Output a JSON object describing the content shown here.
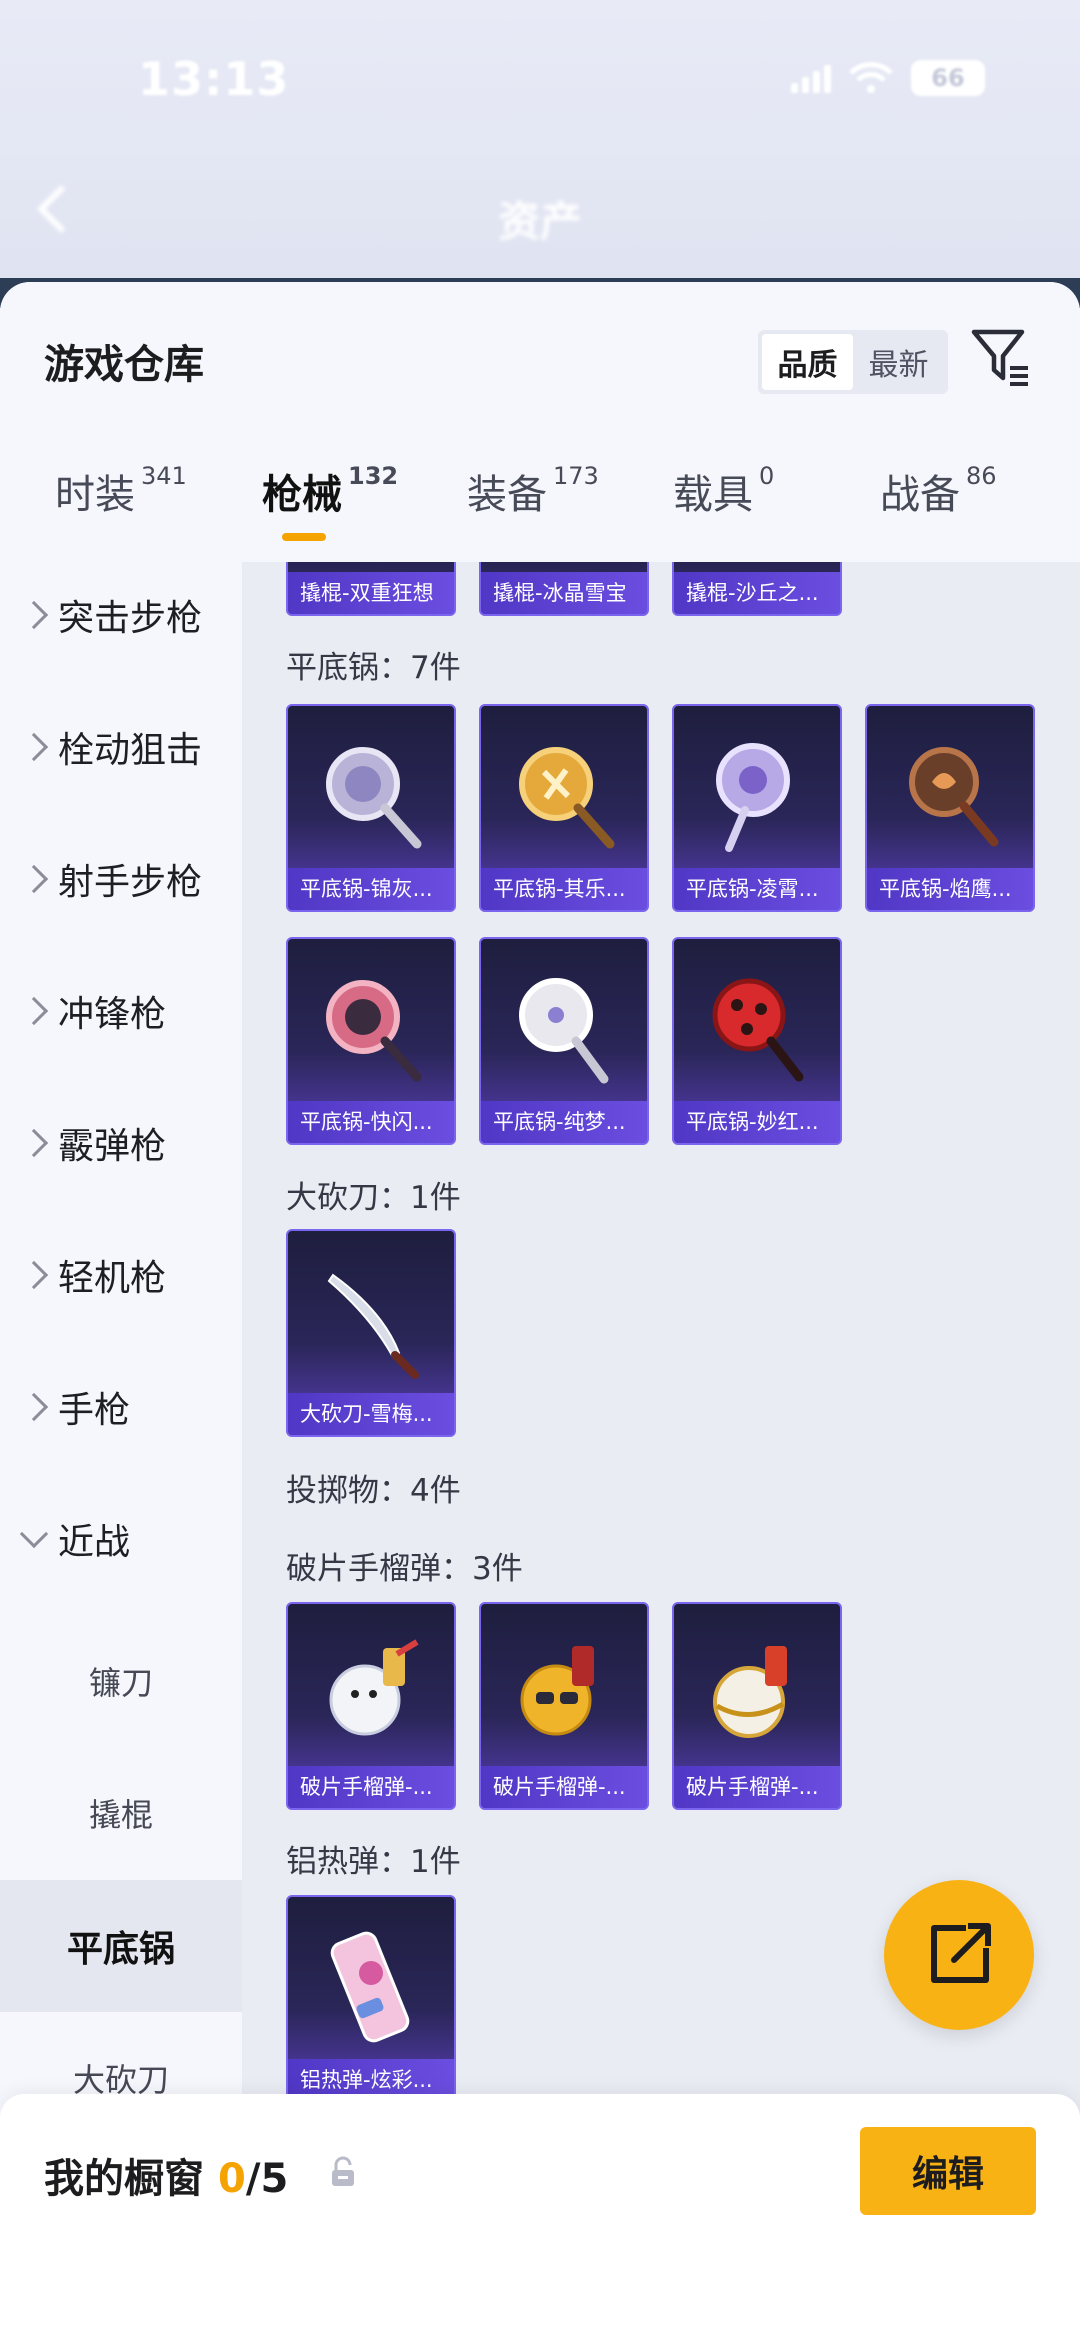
{
  "status_bar": {
    "time": "13:13",
    "battery": "66"
  },
  "header": {
    "title": "资产"
  },
  "sheet": {
    "title": "游戏仓库",
    "sort": {
      "options": [
        "品质",
        "最新"
      ],
      "active": "品质"
    }
  },
  "tabs": [
    {
      "label": "时装",
      "count": "341"
    },
    {
      "label": "枪械",
      "count": "132",
      "active": true
    },
    {
      "label": "装备",
      "count": "173"
    },
    {
      "label": "载具",
      "count": "0"
    },
    {
      "label": "战备",
      "count": "86"
    }
  ],
  "categories": [
    {
      "label": "突击步枪"
    },
    {
      "label": "栓动狙击"
    },
    {
      "label": "射手步枪"
    },
    {
      "label": "冲锋枪"
    },
    {
      "label": "霰弹枪"
    },
    {
      "label": "轻机枪"
    },
    {
      "label": "手枪"
    },
    {
      "label": "近战",
      "expanded": true
    }
  ],
  "subcategories": [
    {
      "label": "镰刀"
    },
    {
      "label": "撬棍"
    },
    {
      "label": "平底锅",
      "active": true
    },
    {
      "label": "大砍刀"
    }
  ],
  "content": {
    "top_row": [
      "撬棍-双重狂想",
      "撬棍-冰晶雪宝",
      "撬棍-沙丘之..."
    ],
    "pan_group": {
      "title": "平底锅：7件",
      "items": [
        "平底锅-锦灰...",
        "平底锅-其乐...",
        "平底锅-凌霄...",
        "平底锅-焰鹰...",
        "平底锅-快闪...",
        "平底锅-纯梦...",
        "平底锅-妙红..."
      ]
    },
    "machete_group": {
      "title": "大砍刀：1件",
      "items": [
        "大砍刀-雪梅..."
      ]
    },
    "throwable_title": "投掷物：4件",
    "frag_group": {
      "title": "破片手榴弹：3件",
      "items": [
        "破片手榴弹-...",
        "破片手榴弹-...",
        "破片手榴弹-..."
      ]
    },
    "thermite_group": {
      "title": "铝热弹：1件",
      "items": [
        "铝热弹-炫彩..."
      ]
    }
  },
  "bottom_bar": {
    "label": "我的橱窗",
    "count": "0",
    "total": "/5",
    "edit_label": "编辑"
  },
  "colors": {
    "accent": "#f9b214",
    "card_border": "#7b65ee",
    "card_label": "#5137c6"
  }
}
